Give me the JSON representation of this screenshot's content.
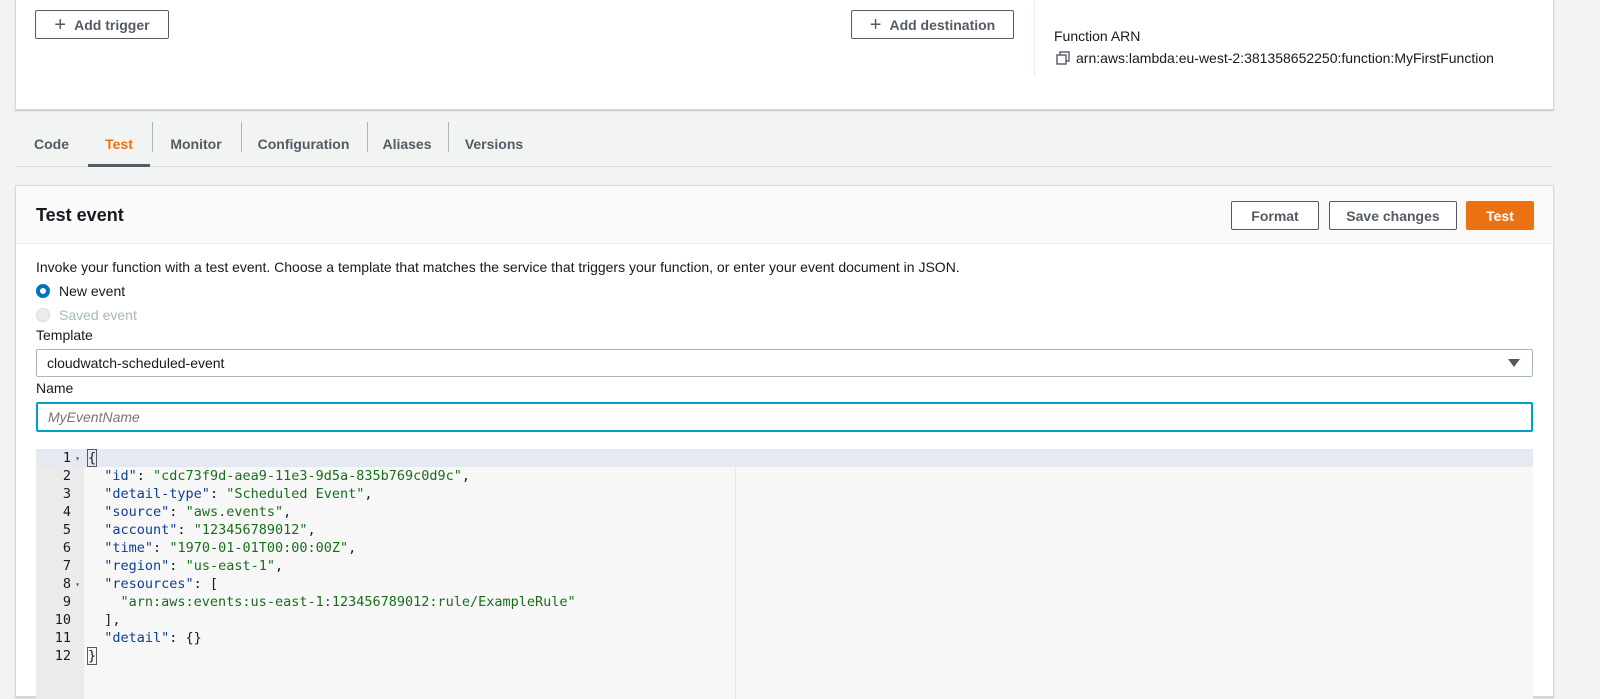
{
  "top_card": {
    "add_trigger_label": "Add trigger",
    "add_destination_label": "Add destination",
    "function_arn_label": "Function ARN",
    "function_arn_value": "arn:aws:lambda:eu-west-2:381358652250:function:MyFirstFunction"
  },
  "tabs": [
    "Code",
    "Test",
    "Monitor",
    "Configuration",
    "Aliases",
    "Versions"
  ],
  "active_tab": "Test",
  "test_event": {
    "title": "Test event",
    "format_label": "Format",
    "save_label": "Save changes",
    "test_label": "Test",
    "description": "Invoke your function with a test event. Choose a template that matches the service that triggers your function, or enter your event document in JSON.",
    "radio_new": "New event",
    "radio_saved": "Saved event",
    "template_label": "Template",
    "template_value": "cloudwatch-scheduled-event",
    "name_label": "Name",
    "name_placeholder": "MyEventName"
  },
  "editor": {
    "lines": [
      "{",
      "  \"id\": \"cdc73f9d-aea9-11e3-9d5a-835b769c0d9c\",",
      "  \"detail-type\": \"Scheduled Event\",",
      "  \"source\": \"aws.events\",",
      "  \"account\": \"123456789012\",",
      "  \"time\": \"1970-01-01T00:00:00Z\",",
      "  \"region\": \"us-east-1\",",
      "  \"resources\": [",
      "    \"arn:aws:events:us-east-1:123456789012:rule/ExampleRule\"",
      "  ],",
      "  \"detail\": {}",
      "}"
    ]
  },
  "colors": {
    "accent": "#ec7211",
    "focus": "#00a1c9",
    "radio_selected": "#0073bb"
  }
}
